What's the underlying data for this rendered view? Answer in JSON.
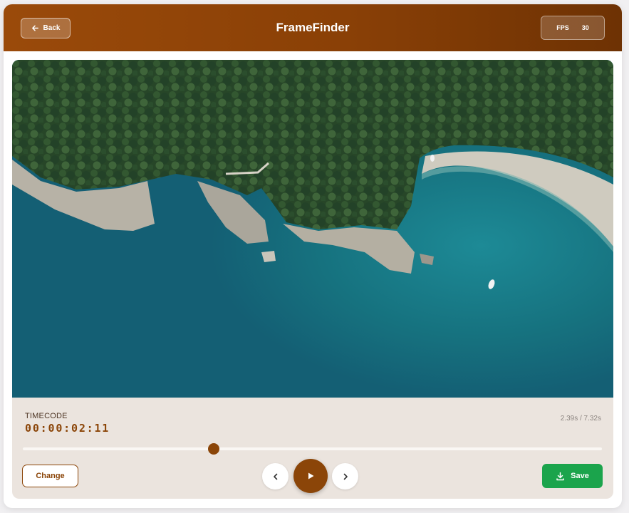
{
  "header": {
    "back_label": "Back",
    "title": "FrameFinder",
    "fps_label": "FPS",
    "fps_value": "30"
  },
  "player": {
    "timecode_label": "TIMECODE",
    "timecode": "00:00:02:11",
    "duration": "2.39s / 7.32s",
    "progress": 0.33
  },
  "controls": {
    "change_label": "Change",
    "save_label": "Save",
    "prev_icon": "chevron-left-icon",
    "play_icon": "play-icon",
    "next_icon": "chevron-right-icon"
  },
  "colors": {
    "accent": "#8b4508",
    "save": "#1ba44c"
  }
}
